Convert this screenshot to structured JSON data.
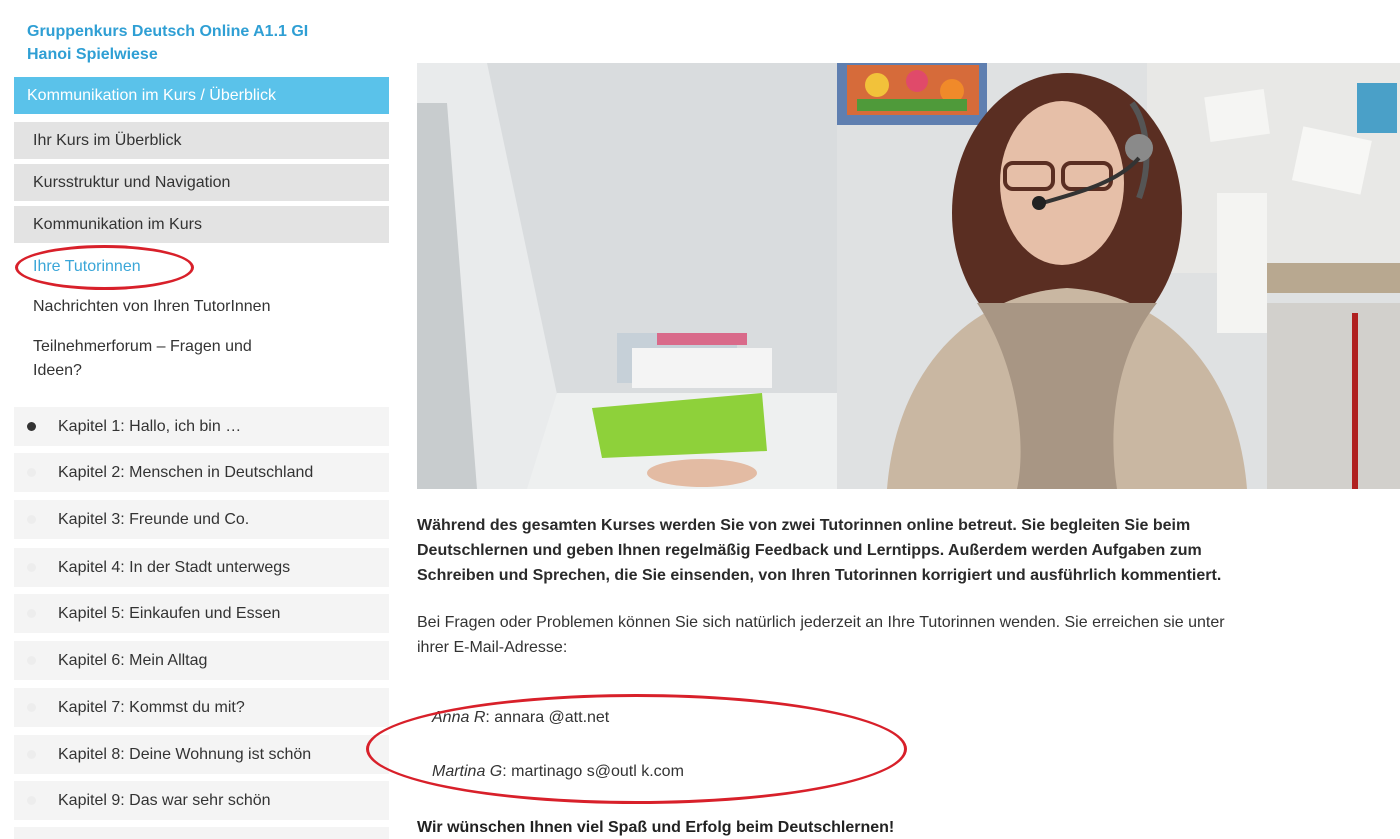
{
  "sidebar": {
    "course_title_line1": "Gruppenkurs Deutsch Online A1.1 GI",
    "course_title_line2": "Hanoi Spielwiese",
    "active_section": "Kommunikation im Kurs / Überblick",
    "overview_items": [
      "Ihr Kurs im Überblick",
      "Kursstruktur und Navigation",
      "Kommunikation im Kurs"
    ],
    "sub_links": [
      "Ihre Tutorinnen",
      "Nachrichten von Ihren TutorInnen",
      "Teilnehmerforum – Fragen und",
      "Ideen?"
    ],
    "chapters": [
      "Kapitel 1: Hallo, ich bin …",
      "Kapitel 2: Menschen in Deutschland",
      "Kapitel 3: Freunde und Co.",
      "Kapitel 4: In der Stadt unterwegs",
      "Kapitel 5: Einkaufen und Essen",
      "Kapitel 6: Mein Alltag",
      "Kapitel 7: Kommst du mit?",
      "Kapitel 8: Deine Wohnung ist schön",
      "Kapitel 9: Das war sehr schön"
    ]
  },
  "content": {
    "intro_bold": [
      "Während des gesamten Kurses werden Sie von zwei Tutorinnen online betreut. Sie begleiten Sie beim",
      "Deutschlernen und geben Ihnen regelmäßig Feedback und Lerntipps. Außerdem werden Aufgaben zum",
      "Schreiben und Sprechen, die Sie einsenden, von Ihren Tutorinnen korrigiert und ausführlich kommentiert."
    ],
    "intro_normal": [
      "Bei Fragen oder Problemen können Sie sich natürlich jederzeit an Ihre Tutorinnen wenden. Sie erreichen sie unter",
      "ihrer E-Mail-Adresse:"
    ],
    "contacts": [
      {
        "name": "Anna R",
        "email": "annara      @att.net"
      },
      {
        "name": "Martina G",
        "email": "martinago      s@outl  k.com"
      }
    ],
    "closing": "Wir wünschen Ihnen viel Spaß und Erfolg beim Deutschlernen!"
  },
  "colors": {
    "link_blue": "#2f9fd4",
    "active_bg": "#5ac2ea",
    "highlight_red": "#d8202a"
  }
}
